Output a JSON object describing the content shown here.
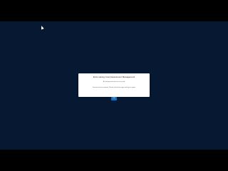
{
  "dialog": {
    "title": "Error saving Cost Assessment Management",
    "subtitle": "An unexpected error has occurred",
    "message": "Your session has expired. Please refresh the page and sign in again.",
    "ok_label": "OK"
  },
  "colors": {
    "desktop_background": "#071833",
    "letterbox": "#000000",
    "dialog_background": "#ffffff",
    "button_accent": "#1f6fb2"
  }
}
